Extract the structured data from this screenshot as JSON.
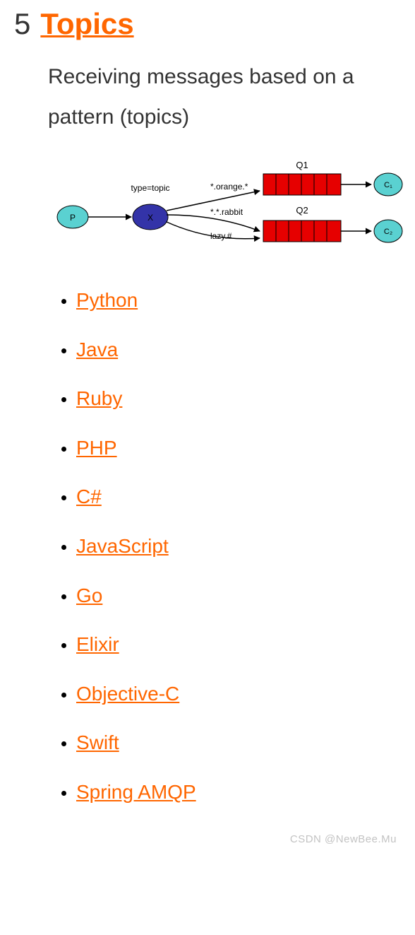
{
  "section": {
    "number": "5",
    "title": "Topics",
    "subtitle": "Receiving messages based on a pattern (topics)"
  },
  "diagram": {
    "producer": "P",
    "exchange": "X",
    "exchange_type_label": "type=topic",
    "bindings": [
      {
        "key": "*.orange.*"
      },
      {
        "key": "*.*.rabbit"
      },
      {
        "key": "lazy.#"
      }
    ],
    "queues": [
      "Q1",
      "Q2"
    ],
    "consumers": [
      "C₁",
      "C₂"
    ]
  },
  "languages": [
    "Python",
    "Java",
    "Ruby",
    "PHP",
    "C#",
    "JavaScript",
    "Go",
    "Elixir",
    "Objective-C",
    "Swift",
    "Spring AMQP"
  ],
  "watermark": "CSDN @NewBee.Mu"
}
